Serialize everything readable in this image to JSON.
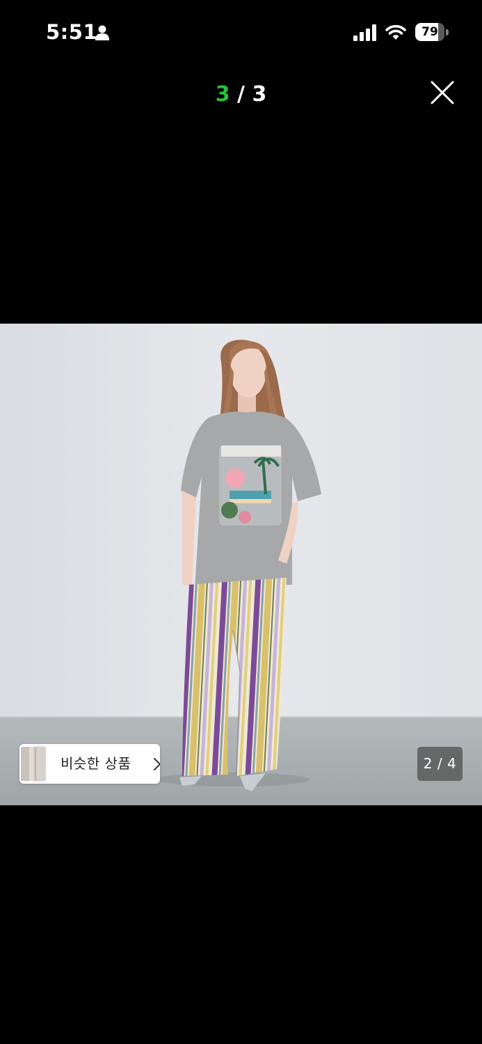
{
  "status_bar": {
    "time": "5:51",
    "battery_level": "79",
    "icons": [
      "person-icon",
      "cellular-signal-icon",
      "wifi-icon",
      "battery-icon"
    ]
  },
  "viewer": {
    "current": "3",
    "separator": "/",
    "total": "3",
    "close_icon": "close-icon"
  },
  "photo": {
    "alt_description": "product-photo",
    "similar_products_label": "비슷한 상품",
    "page_indicator": "2 / 4"
  },
  "colors": {
    "background": "#000000",
    "counter_accent": "#2bbf3a",
    "text": "#ffffff"
  }
}
